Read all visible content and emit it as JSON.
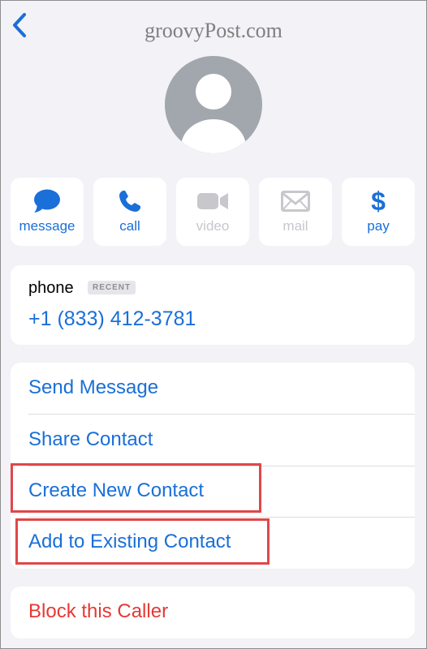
{
  "watermark": "groovyPost.com",
  "actions": [
    {
      "label": "message",
      "icon": "message-bubble-icon",
      "enabled": true
    },
    {
      "label": "call",
      "icon": "phone-icon",
      "enabled": true
    },
    {
      "label": "video",
      "icon": "video-camera-icon",
      "enabled": false
    },
    {
      "label": "mail",
      "icon": "envelope-icon",
      "enabled": false
    },
    {
      "label": "pay",
      "icon": "dollar-icon",
      "enabled": true
    }
  ],
  "phone": {
    "label": "phone",
    "badge": "RECENT",
    "number": "+1 (833) 412-3781"
  },
  "options": [
    {
      "label": "Send Message"
    },
    {
      "label": "Share Contact"
    },
    {
      "label": "Create New Contact",
      "highlighted": true
    },
    {
      "label": "Add to Existing Contact",
      "highlighted": true
    }
  ],
  "block": {
    "label": "Block this Caller"
  },
  "colors": {
    "accent": "#1a6fd8",
    "destructive": "#e53935",
    "highlight": "#e0474a",
    "background": "#f2f2f7",
    "disabled": "#c7c7cc"
  },
  "$": "$"
}
